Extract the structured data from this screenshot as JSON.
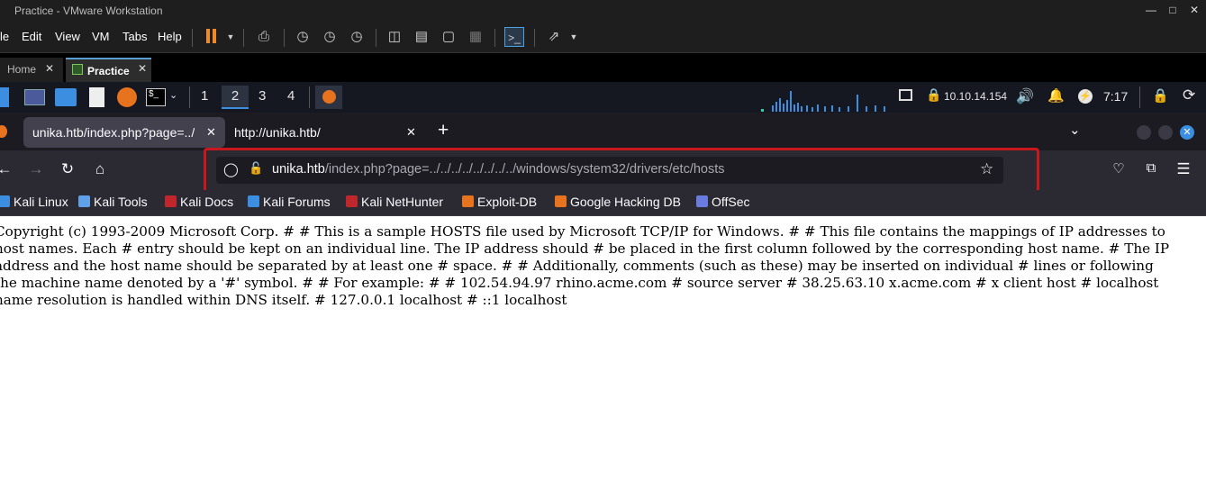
{
  "window": {
    "title": "Practice - VMware Workstation",
    "minimize_icon": "minimize-icon",
    "maximize_icon": "maximize-icon",
    "close_icon": "close-icon"
  },
  "menu": {
    "items": [
      "le",
      "Edit",
      "View",
      "VM",
      "Tabs",
      "Help"
    ]
  },
  "vm_tabs": {
    "home_label": "Home",
    "practice_label": "Practice"
  },
  "kali_panel": {
    "workspaces": [
      "1",
      "2",
      "3",
      "4"
    ],
    "active_workspace": "2",
    "ip": "10.10.14.154",
    "time": "7:17"
  },
  "browser": {
    "tabs": [
      {
        "label": "unika.htb/index.php?page=../",
        "active": true
      },
      {
        "label": "http://unika.htb/",
        "active": false
      }
    ],
    "url_host": "unika.htb",
    "url_path": "/index.php?page=../../../../../../../../windows/system32/drivers/etc/hosts",
    "bookmarks": [
      {
        "label": "Kali Linux",
        "color": "#3c8ee0"
      },
      {
        "label": "Kali Tools",
        "color": "#5fa0e8"
      },
      {
        "label": "Kali Docs",
        "color": "#c0272d"
      },
      {
        "label": "Kali Forums",
        "color": "#3c8ee0"
      },
      {
        "label": "Kali NetHunter",
        "color": "#c0272d"
      },
      {
        "label": "Exploit-DB",
        "color": "#e8731f"
      },
      {
        "label": "Google Hacking DB",
        "color": "#e8731f"
      },
      {
        "label": "OffSec",
        "color": "#6a7be0"
      }
    ]
  },
  "page": {
    "text": "Copyright (c) 1993-2009 Microsoft Corp. # # This is a sample HOSTS file used by Microsoft TCP/IP for Windows. # # This file contains the mappings of IP addresses to host names. Each # entry should be kept on an individual line. The IP address should # be placed in the first column followed by the corresponding host name. # The IP address and the host name should be separated by at least one # space. # # Additionally, comments (such as these) may be inserted on individual # lines or following the machine name denoted by a '#' symbol. # # For example: # # 102.54.94.97 rhino.acme.com # source server # 38.25.63.10 x.acme.com # x client host # localhost name resolution is handled within DNS itself. # 127.0.0.1 localhost # ::1 localhost"
  },
  "colors": {
    "accent_orange": "#f08a24",
    "highlight_red": "#c8181e",
    "firefox_bg": "#2b2a33"
  }
}
